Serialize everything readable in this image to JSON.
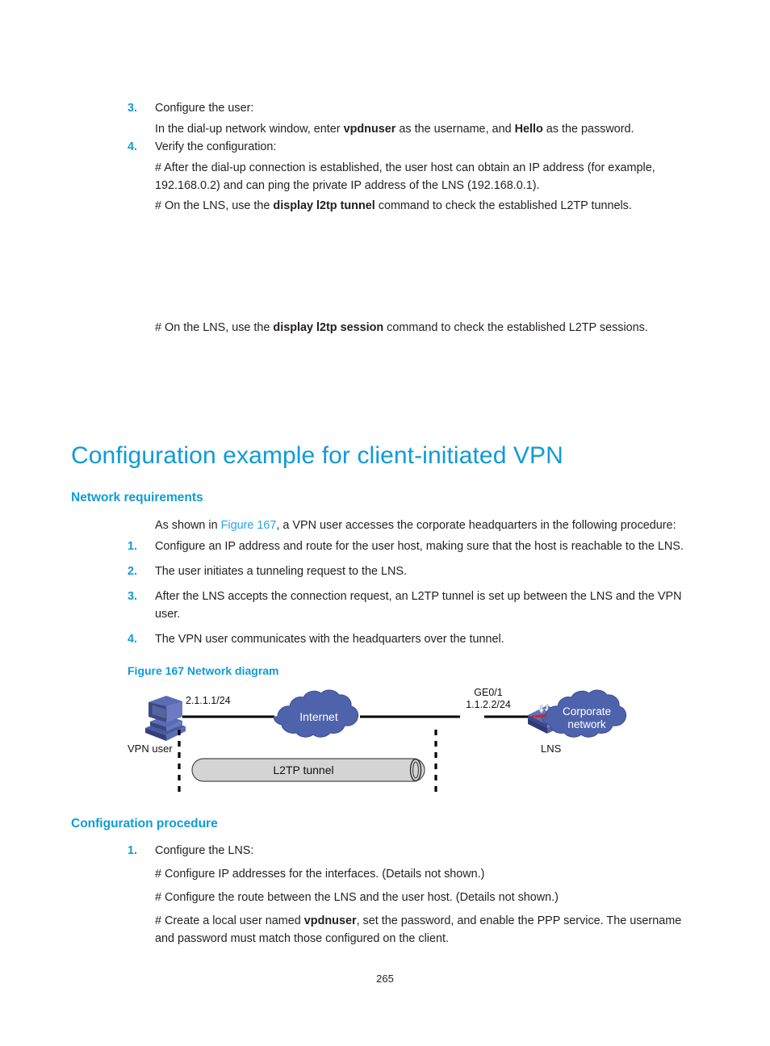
{
  "top_section": {
    "items": [
      {
        "num": "3.",
        "text": "Configure the user:",
        "sub_lines": [
          {
            "segments": [
              {
                "t": "In the dial-up network window, enter ",
                "b": false
              },
              {
                "t": "vpdnuser",
                "b": true
              },
              {
                "t": " as the username, and ",
                "b": false
              },
              {
                "t": "Hello",
                "b": true
              },
              {
                "t": " as the password.",
                "b": false
              }
            ]
          }
        ]
      },
      {
        "num": "4.",
        "text": "Verify the configuration:",
        "sub_lines": [
          {
            "segments": [
              {
                "t": "# After the dial-up connection is established, the user host can obtain an IP address (for example, 192.168.0.2) and can ping the private IP address of the LNS (192.168.0.1).",
                "b": false
              }
            ]
          },
          {
            "segments": [
              {
                "t": "# On the LNS, use the ",
                "b": false
              },
              {
                "t": "display l2tp tunnel",
                "b": true
              },
              {
                "t": " command to check the established L2TP tunnels.",
                "b": false
              }
            ]
          }
        ]
      }
    ],
    "session_line": [
      {
        "t": "# On the LNS, use the ",
        "b": false
      },
      {
        "t": "display l2tp session",
        "b": true
      },
      {
        "t": " command to check the established L2TP sessions.",
        "b": false
      }
    ]
  },
  "main_heading": "Configuration example for client-initiated VPN",
  "network_requirements": {
    "heading": "Network requirements",
    "intro": [
      {
        "t": "As shown in ",
        "b": false,
        "link": false
      },
      {
        "t": "Figure 167",
        "b": false,
        "link": true
      },
      {
        "t": ", a VPN user accesses the corporate headquarters in the following procedure:",
        "b": false,
        "link": false
      }
    ],
    "items": [
      {
        "num": "1.",
        "text": "Configure an IP address and route for the user host, making sure that the host is reachable to the LNS."
      },
      {
        "num": "2.",
        "text": "The user initiates a tunneling request to the LNS."
      },
      {
        "num": "3.",
        "text": "After the LNS accepts the connection request, an L2TP tunnel is set up between the LNS and the VPN user."
      },
      {
        "num": "4.",
        "text": "The VPN user communicates with the headquarters over the tunnel."
      }
    ]
  },
  "figure": {
    "caption": "Figure 167 Network diagram",
    "labels": {
      "vpn_user": "VPN user",
      "user_ip": "2.1.1.1/24",
      "internet": "Internet",
      "ge_interface": "GE0/1",
      "lns_ip": "1.1.2.2/24",
      "lns": "LNS",
      "corporate_network_line1": "Corporate",
      "corporate_network_line2": "network",
      "tunnel": "L2TP tunnel"
    },
    "colors": {
      "cloud_fill": "#4e63ab",
      "cloud_stroke": "#3c4f91",
      "device_blue": "#5a6bb0",
      "device_dark": "#3c4a86",
      "router_red": "#e02020",
      "tunnel_fill": "#d4d4d4",
      "link_line": "#000000"
    }
  },
  "configuration_procedure": {
    "heading": "Configuration procedure",
    "items": [
      {
        "num": "1.",
        "text": "Configure the LNS:",
        "sub_lines": [
          {
            "segments": [
              {
                "t": "# Configure IP addresses for the interfaces. (Details not shown.)",
                "b": false
              }
            ]
          },
          {
            "segments": [
              {
                "t": "# Configure the route between the LNS and the user host. (Details not shown.)",
                "b": false
              }
            ]
          },
          {
            "segments": [
              {
                "t": "# Create a local user named ",
                "b": false
              },
              {
                "t": "vpdnuser",
                "b": true
              },
              {
                "t": ", set the password, and enable the PPP service. The username and password must match those configured on the client.",
                "b": false
              }
            ]
          }
        ]
      }
    ]
  },
  "footer": {
    "page_number": "265"
  },
  "theme": {
    "accent_blue": "#0f9bd7",
    "link_blue": "#2aa3dd",
    "text": "#231f20"
  }
}
